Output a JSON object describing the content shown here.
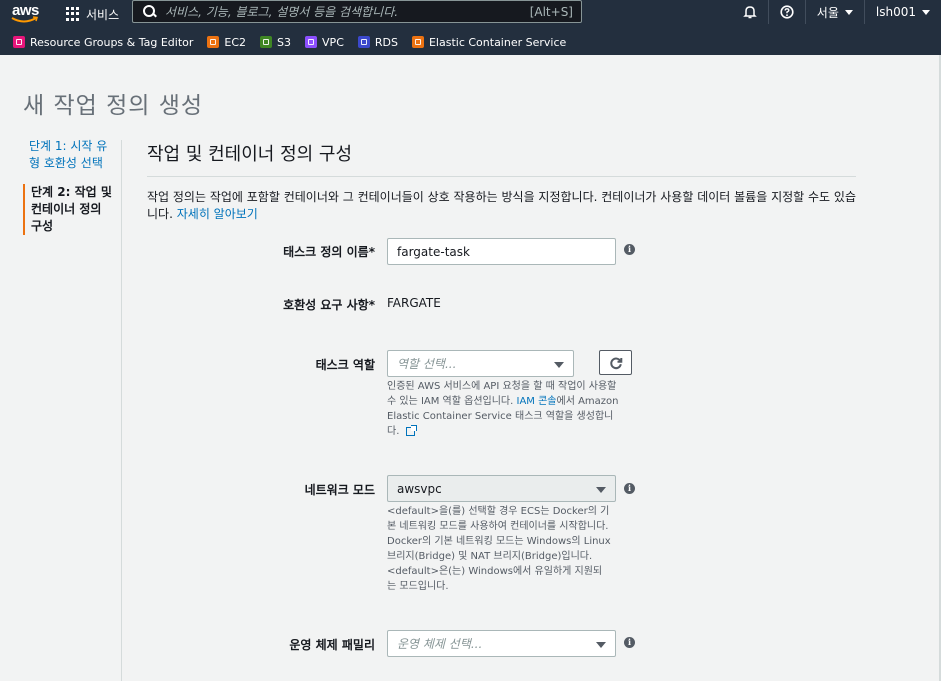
{
  "topbar": {
    "logo": "aws",
    "services_label": "서비스",
    "search_placeholder": "서비스, 기능, 블로그, 설명서 등을 검색합니다.",
    "search_shortcut": "[Alt+S]",
    "region": "서울",
    "user": "lsh001",
    "icons": [
      "grid-icon",
      "search-icon",
      "bell-icon",
      "help-icon"
    ]
  },
  "favorites": [
    {
      "label": "Resource Groups & Tag Editor",
      "color": "#e7157b"
    },
    {
      "label": "EC2",
      "color": "#ec7211"
    },
    {
      "label": "S3",
      "color": "#3f8624"
    },
    {
      "label": "VPC",
      "color": "#8c4fff"
    },
    {
      "label": "RDS",
      "color": "#3b48cc"
    },
    {
      "label": "Elastic Container Service",
      "color": "#ec7211"
    }
  ],
  "page": {
    "title": "새 작업 정의 생성"
  },
  "steps": [
    {
      "label": "단계 1: 시작 유형 호환성 선택"
    },
    {
      "label": "단계 2: 작업 및 컨테이너 정의 구성"
    }
  ],
  "section": {
    "title": "작업 및 컨테이너 정의 구성",
    "description": "작업 정의는 작업에 포함할 컨테이너와 그 컨테이너들이 상호 작용하는 방식을 지정합니다. 컨테이너가 사용할 데이터 볼륨을 지정할 수도 있습니다.",
    "learn_more": "자세히 알아보기"
  },
  "form": {
    "task_def_name": {
      "label": "태스크 정의 이름*",
      "value": "fargate-task"
    },
    "compat": {
      "label": "호환성 요구 사항*",
      "value": "FARGATE"
    },
    "task_role": {
      "label": "태스크 역할",
      "placeholder": "역할 선택...",
      "help_before": "인증된 AWS 서비스에 API 요청을 할 때 작업이 사용할 수 있는 IAM 역할 옵션입니다.",
      "help_link": "IAM 콘솔",
      "help_after": "에서 Amazon Elastic Container Service 태스크 역할을 생성합니다."
    },
    "network_mode": {
      "label": "네트워크 모드",
      "value": "awsvpc",
      "help": "<default>을(를) 선택할 경우 ECS는 Docker의 기본 네트워킹 모드를 사용하여 컨테이너를 시작합니다. Docker의 기본 네트워킹 모드는 Windows의 Linux 브리지(Bridge) 및 NAT 브리지(Bridge)입니다. <default>은(는) Windows에서 유일하게 지원되는 모드입니다."
    },
    "os_family": {
      "label": "운영 체제 패밀리",
      "placeholder": "운영 체제 선택..."
    }
  }
}
